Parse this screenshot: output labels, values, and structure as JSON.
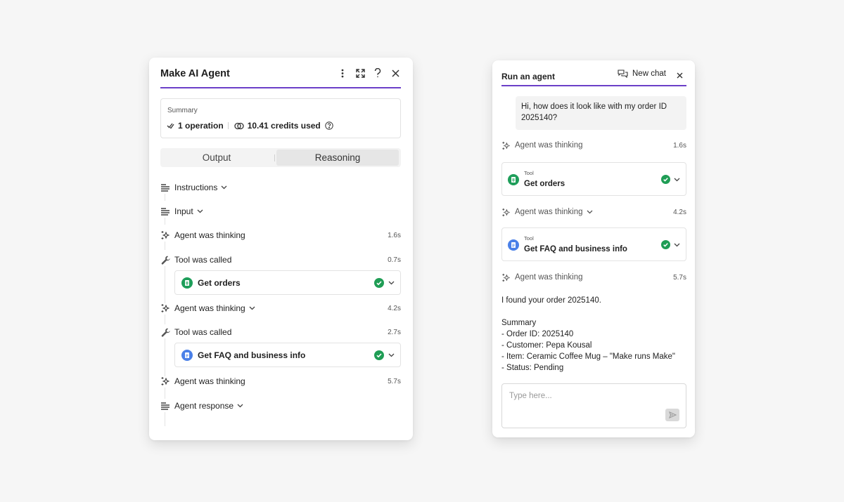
{
  "left_panel": {
    "title": "Make AI Agent",
    "header_icons": [
      "more-vertical-icon",
      "expand-icon",
      "help-icon",
      "close-icon"
    ],
    "summary": {
      "label": "Summary",
      "operations": "1 operation",
      "credits": "10.41 credits used"
    },
    "tabs": [
      {
        "label": "Output",
        "selected": false
      },
      {
        "label": "Reasoning",
        "selected": true
      }
    ],
    "timeline": [
      {
        "icon": "text-lines-icon",
        "label": "Instructions",
        "expandable": true
      },
      {
        "icon": "text-lines-icon",
        "label": "Input",
        "expandable": true
      },
      {
        "icon": "sparkle-icon",
        "label": "Agent was thinking",
        "time": "1.6s"
      },
      {
        "icon": "wrench-icon",
        "label": "Tool was called",
        "time": "0.7s"
      },
      {
        "icon": "sparkle-icon",
        "label": "Agent was thinking",
        "time": "4.2s",
        "expandable": true
      },
      {
        "icon": "wrench-icon",
        "label": "Tool was called",
        "time": "2.7s"
      },
      {
        "icon": "sparkle-icon",
        "label": "Agent was thinking",
        "time": "5.7s"
      },
      {
        "icon": "text-lines-icon",
        "label": "Agent response",
        "expandable": true
      }
    ],
    "tools": [
      {
        "name": "Get orders",
        "icon": "sheets-icon",
        "status": "success"
      },
      {
        "name": "Get FAQ and business info",
        "icon": "docs-icon",
        "status": "success"
      }
    ]
  },
  "right_panel": {
    "title": "Run an agent",
    "new_chat_label": "New chat",
    "user_message": "Hi, how does it look like with my order ID 2025140?",
    "thinking": [
      {
        "label": "Agent was thinking",
        "time": "1.6s"
      },
      {
        "label": "Agent was thinking",
        "time": "4.2s"
      },
      {
        "label": "Agent was thinking",
        "time": "5.7s"
      }
    ],
    "tools": [
      {
        "caption": "Tool",
        "name": "Get orders",
        "status": "success"
      },
      {
        "caption": "Tool",
        "name": "Get FAQ and business info",
        "status": "success"
      }
    ],
    "response": {
      "intro": "I found your order 2025140.",
      "lines": [
        "Summary",
        "- Order ID: 2025140",
        "- Customer: Pepa Kousal",
        "- Item: Ceramic Coffee Mug – \"Make runs Make\"",
        "- Status: Pending"
      ]
    },
    "input": {
      "value": "",
      "placeholder": "Type here..."
    }
  },
  "colors": {
    "accent": "#6b3fc8",
    "success": "#1f9d55",
    "sheets": "#1e9e5a",
    "docs": "#4a80e8",
    "background": "#f6f6f6"
  }
}
